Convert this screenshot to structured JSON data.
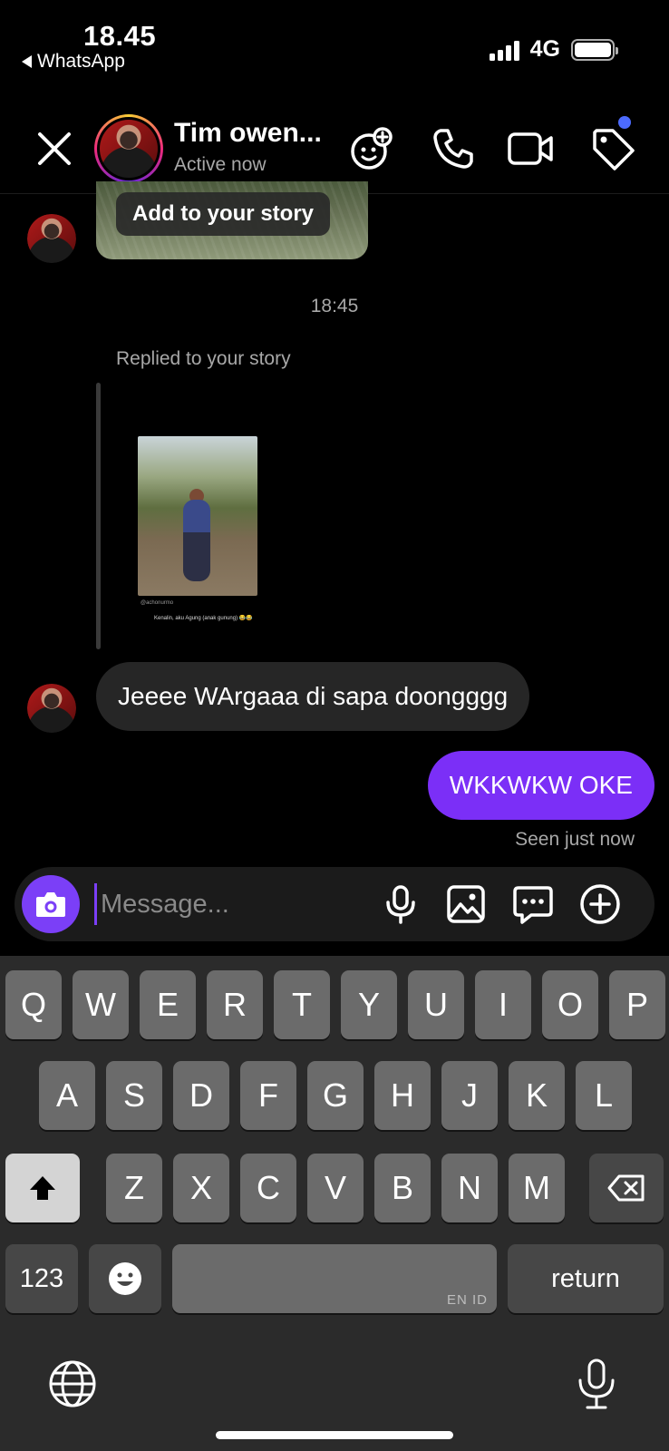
{
  "status_bar": {
    "time": "18.45",
    "back_app": "WhatsApp",
    "network": "4G"
  },
  "header": {
    "contact_name": "Tim owen...",
    "contact_status": "Active now",
    "icons": [
      "close-icon",
      "avatar",
      "effects-icon",
      "phone-icon",
      "video-camera-icon",
      "tag-icon"
    ]
  },
  "chat": {
    "add_story_label": "Add to your story",
    "timestamp": "18:45",
    "replied_label": "Replied to your story",
    "story_credit": "@achonurmo",
    "story_caption": "Kenalin, aku Agung (anak gunung) 😂😂",
    "incoming_message": "Jeeee WArgaaa di sapa doongggg",
    "outgoing_message": "WKKWKW OKE",
    "seen_status": "Seen just now"
  },
  "composer": {
    "placeholder": "Message...",
    "icons": [
      "camera-icon",
      "microphone-icon",
      "gallery-icon",
      "sticker-icon",
      "add-icon"
    ]
  },
  "keyboard": {
    "row1": [
      "Q",
      "W",
      "E",
      "R",
      "T",
      "Y",
      "U",
      "I",
      "O",
      "P"
    ],
    "row2": [
      "A",
      "S",
      "D",
      "F",
      "G",
      "H",
      "J",
      "K",
      "L"
    ],
    "row3": [
      "Z",
      "X",
      "C",
      "V",
      "B",
      "N",
      "M"
    ],
    "numbers_key": "123",
    "return_key": "return",
    "space_lang": "EN ID"
  },
  "colors": {
    "accent": "#7b3ff7",
    "outgoing_bubble": "#7b2ff7",
    "incoming_bubble": "#262626",
    "badge": "#4c6bff"
  }
}
